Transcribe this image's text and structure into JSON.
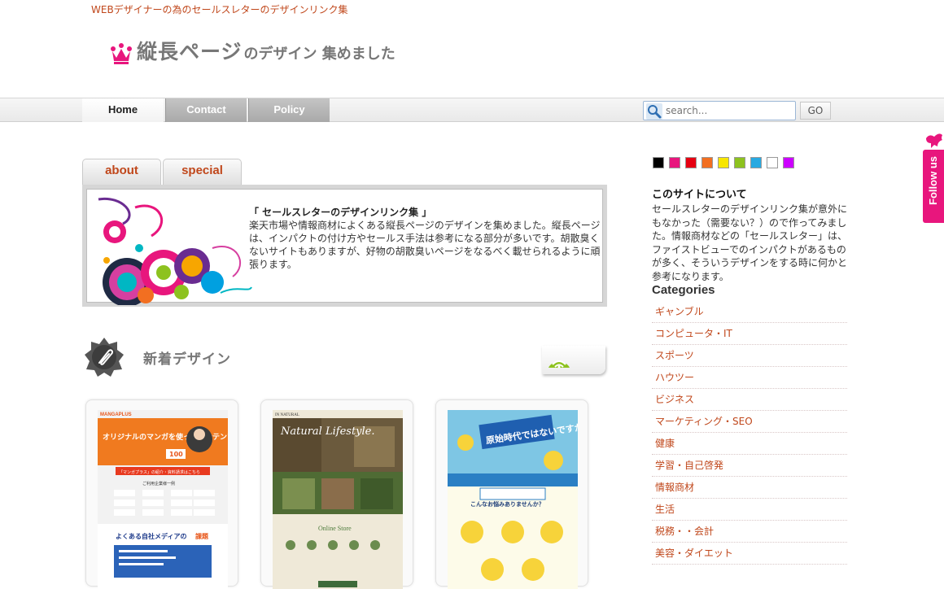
{
  "header": {
    "tagline": "WEBデザイナーの為のセールスレターのデザインリンク集",
    "logo_main": "縦長ページ",
    "logo_sub": "のデザイン 集めました"
  },
  "nav": {
    "items": [
      "Home",
      "Contact",
      "Policy"
    ],
    "search_placeholder": "search...",
    "go_label": "GO"
  },
  "tabs": [
    "about",
    "special"
  ],
  "about": {
    "title": "「 セールスレターのデザインリンク集 」",
    "text": "楽天市場や情報商材によくある縦長ページのデザインを集めました。縦長ページは、インパクトの付け方やセールス手法は参考になる部分が多いです。胡散臭くないサイトもありますが、好物の胡散臭いページをなるべく載せられるように頑張ります。"
  },
  "new_designs": {
    "title": "新着デザイン"
  },
  "cards": [
    {
      "brand": "MANGAPLUS",
      "headline": "オリジナルのマンガを使ったコンテンツ",
      "badge": "100",
      "cta": "「マンガプラス」の紹介・資料請求はこちら",
      "clients_title": "ご利用企業様一例",
      "bottom_text": "よくある自社メディアの",
      "bottom_highlight": "課題"
    },
    {
      "brand": "IN NATURAL",
      "hero_text": "Natural Lifestyle.",
      "store_title": "Online Store"
    },
    {
      "hero_text": "原始時代ではないですか?",
      "question": "こんなお悩みありませんか？"
    }
  ],
  "sidebar": {
    "swatches": [
      "#000000",
      "#e8167d",
      "#e60012",
      "#f26f21",
      "#f7e600",
      "#8dc21f",
      "#28a9e1",
      "#ffffff",
      "#cc00ff"
    ],
    "about_title": "このサイトについて",
    "about_text": "セールスレターのデザインリンク集が意外にもなかった（需要ない？）ので作ってみました。情報商材などの「セールスレター」は、ファイストビューでのインパクトがあるものが多く、そういうデザインをする時に何かと参考になります。",
    "categories_title": "Categories",
    "categories": [
      "ギャンブル",
      "コンピュータ・IT",
      "スポーツ",
      "ハウツー",
      "ビジネス",
      "マーケティング・SEO",
      "健康",
      "学習・自己啓発",
      "情報商材",
      "生活",
      "税務・・会計",
      "美容・ダイエット"
    ]
  },
  "follow": {
    "label": "Follow us"
  },
  "colors": {
    "accent": "#c0471b",
    "pink": "#e8167d"
  }
}
